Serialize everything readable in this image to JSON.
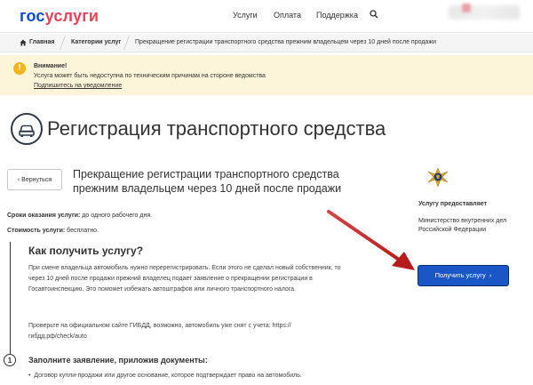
{
  "header": {
    "logo": {
      "part1": "гос",
      "part2": "услуги"
    },
    "nav": [
      "Услуги",
      "Оплата",
      "Поддержка"
    ]
  },
  "breadcrumb": [
    "Главная",
    "Категории услуг",
    "Прекращение регистрации транспортного средства прежним владельцем через 10 дней после продажи"
  ],
  "alert": {
    "title": "Внимание!",
    "text": "Услуга может быть недоступна по техническим причинам на стороне ведомства",
    "link": "Подпишитесь на уведомление"
  },
  "page": {
    "title": "Регистрация транспортного средства",
    "back_button": "Вернуться",
    "service_title": "Прекращение регистрации транспортного средства прежним владельцем через 10 дней после продажи",
    "term_label": "Сроки оказания услуги:",
    "term_value": "до одного рабочего дня.",
    "cost_label": "Стоимость услуги:",
    "cost_value": "бесплатно."
  },
  "how_to": {
    "title": "Как получить услугу?",
    "paragraph1": "При смене владельца автомобиль нужно перерегистрировать. Если этого не сделал новый собственник, то через 10 дней после продажи прежний владелец подает заявление о прекращении регистрации в Госавтоинспекцию. Это поможет избежать автоштрафов или личного транспортного налога.",
    "paragraph2": "Проверьте на официальном сайте ГИБДД, возможно, автомобиль уже снят с учета: https://гибдд.рф/check/auto",
    "step_number": "1",
    "step_title": "Заполните заявление, приложив документы:",
    "bullet1": "Договор купли-продажи или другое основание, которое подтверждает право на автомобиль."
  },
  "sidebar": {
    "provider_label": "Услугу предоставляет",
    "provider_name": "Министерство внутренних дел Российской Федерации",
    "get_button": "Получить услугу"
  },
  "colors": {
    "brand_blue": "#0d4cd3",
    "brand_red": "#ee3f58",
    "alert_bg": "#fcf5da",
    "button": "#1b56c6",
    "arrow": "#c62828"
  }
}
